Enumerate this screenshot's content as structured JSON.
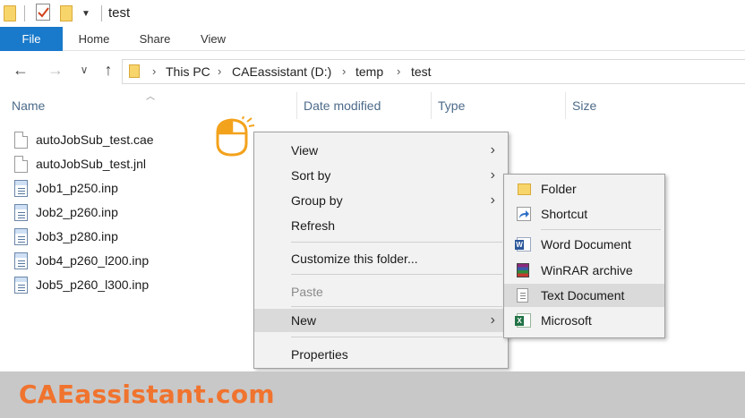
{
  "window": {
    "title": "test"
  },
  "ribbon": {
    "tabs": [
      "File",
      "Home",
      "Share",
      "View"
    ],
    "active_tab": "File",
    "accent": "#1979ca"
  },
  "address": {
    "segments": [
      "This PC",
      "CAEassistant (D:)",
      "temp",
      "test"
    ]
  },
  "columns": {
    "name": "Name",
    "date_modified": "Date modified",
    "type": "Type",
    "size": "Size"
  },
  "files": [
    {
      "name": "autoJobSub_test.cae",
      "icon": "generic-file-icon"
    },
    {
      "name": "autoJobSub_test.jnl",
      "icon": "generic-file-icon"
    },
    {
      "name": "Job1_p250.inp",
      "icon": "inp-file-icon"
    },
    {
      "name": "Job2_p260.inp",
      "icon": "inp-file-icon"
    },
    {
      "name": "Job3_p280.inp",
      "icon": "inp-file-icon"
    },
    {
      "name": "Job4_p260_l200.inp",
      "icon": "inp-file-icon"
    },
    {
      "name": "Job5_p260_l300.inp",
      "icon": "inp-file-icon"
    }
  ],
  "context_menu": {
    "view": "View",
    "sort_by": "Sort by",
    "group_by": "Group by",
    "refresh": "Refresh",
    "customize": "Customize this folder...",
    "paste": "Paste",
    "new": "New",
    "properties": "Properties",
    "submenu_arrow": "›"
  },
  "new_submenu": {
    "folder": "Folder",
    "shortcut": "Shortcut",
    "word": "Word Document",
    "winrar": "WinRAR archive",
    "text": "Text Document",
    "microsoft": "Microsoft"
  },
  "banner": {
    "text": "CAEassistant.com",
    "color": "#f0732e"
  }
}
